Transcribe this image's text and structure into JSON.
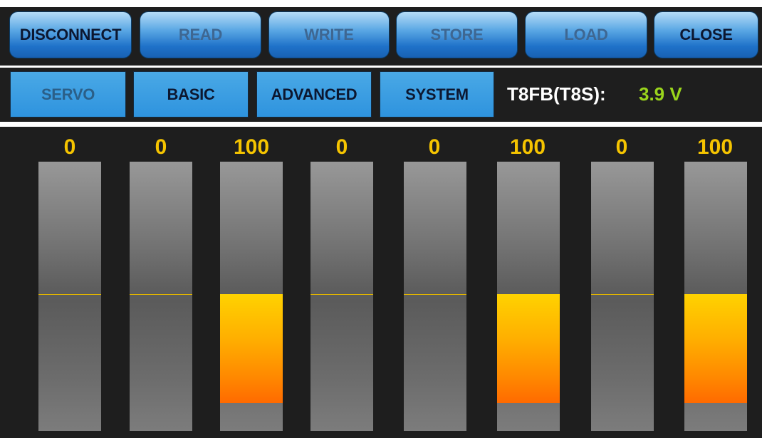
{
  "toolbar": {
    "buttons": [
      {
        "label": "DISCONNECT",
        "enabled": true
      },
      {
        "label": "READ",
        "enabled": false
      },
      {
        "label": "WRITE",
        "enabled": false
      },
      {
        "label": "STORE",
        "enabled": false
      },
      {
        "label": "LOAD",
        "enabled": false
      },
      {
        "label": "CLOSE",
        "enabled": true
      }
    ]
  },
  "tabs": [
    {
      "label": "SERVO",
      "active": true
    },
    {
      "label": "BASIC",
      "active": false
    },
    {
      "label": "ADVANCED",
      "active": false
    },
    {
      "label": "SYSTEM",
      "active": false
    }
  ],
  "status": {
    "device": "T8FB(T8S):",
    "voltage": "3.9 V",
    "voltage_color": "#9ad51c"
  },
  "channels": [
    {
      "value": "0",
      "level": 0
    },
    {
      "value": "0",
      "level": 0
    },
    {
      "value": "100",
      "level": 100
    },
    {
      "value": "0",
      "level": 0
    },
    {
      "value": "0",
      "level": 0
    },
    {
      "value": "100",
      "level": 100
    },
    {
      "value": "0",
      "level": 0
    },
    {
      "value": "100",
      "level": 100
    }
  ],
  "colors": {
    "background": "#1e1e1e",
    "button_blue": "#1f72c9",
    "tab_blue": "#2e93de",
    "value_yellow": "#f5c400",
    "fill_orange": "#ff8a00"
  }
}
